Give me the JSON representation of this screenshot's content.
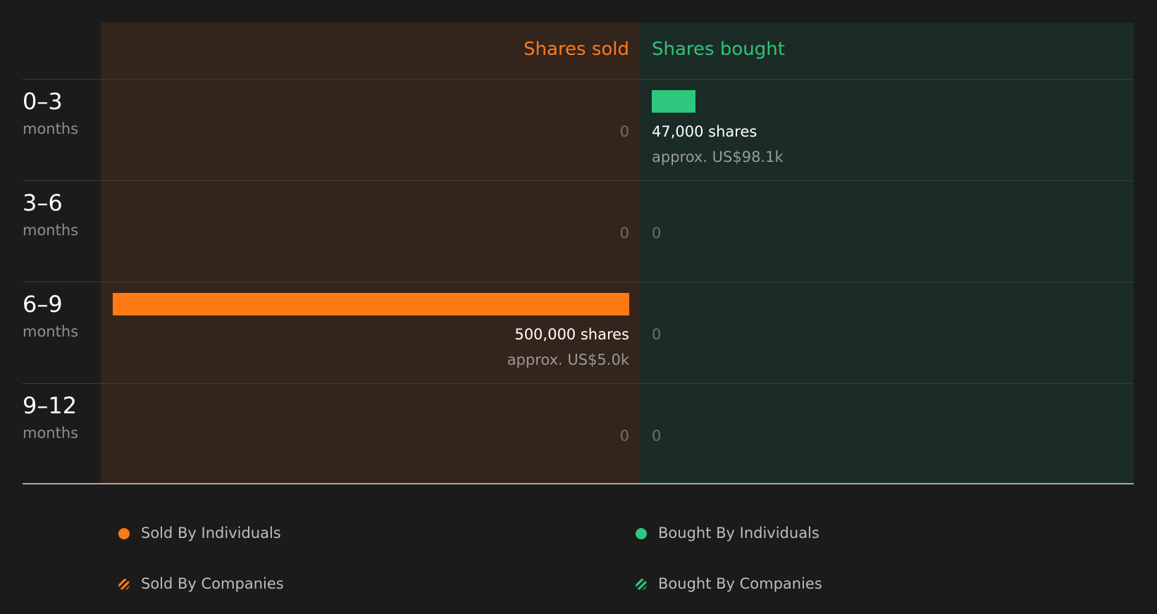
{
  "colors": {
    "sold": "#ff7a15",
    "bought": "#2ec77d",
    "sold_panel": "#33241c",
    "bought_panel": "#1b2b25",
    "background": "#1b1b1b"
  },
  "chart_data": {
    "type": "bar",
    "orientation": "horizontal-diverging",
    "column_headers": {
      "sold": "Shares sold",
      "bought": "Shares bought"
    },
    "categories": [
      {
        "range": "0–3",
        "unit": "months"
      },
      {
        "range": "3–6",
        "unit": "months"
      },
      {
        "range": "6–9",
        "unit": "months"
      },
      {
        "range": "9–12",
        "unit": "months"
      }
    ],
    "sold_max": 500000,
    "bought_max": 500000,
    "series": [
      {
        "name": "Shares sold",
        "values": [
          0,
          0,
          500000,
          0
        ],
        "zero_labels": [
          "0",
          "0",
          "",
          "0"
        ],
        "share_labels": [
          "",
          "",
          "500,000 shares",
          ""
        ],
        "value_labels": [
          "",
          "",
          "approx. US$5.0k",
          ""
        ]
      },
      {
        "name": "Shares bought",
        "values": [
          47000,
          0,
          0,
          0
        ],
        "zero_labels": [
          "",
          "0",
          "0",
          "0"
        ],
        "share_labels": [
          "47,000 shares",
          "",
          "",
          ""
        ],
        "value_labels": [
          "approx. US$98.1k",
          "",
          "",
          ""
        ]
      }
    ],
    "legend": [
      {
        "label": "Sold By Individuals",
        "icon": "filled-dot-orange"
      },
      {
        "label": "Bought By Individuals",
        "icon": "filled-dot-green"
      },
      {
        "label": "Sold By Companies",
        "icon": "hatched-dot-orange"
      },
      {
        "label": "Bought By Companies",
        "icon": "hatched-dot-green"
      }
    ]
  }
}
